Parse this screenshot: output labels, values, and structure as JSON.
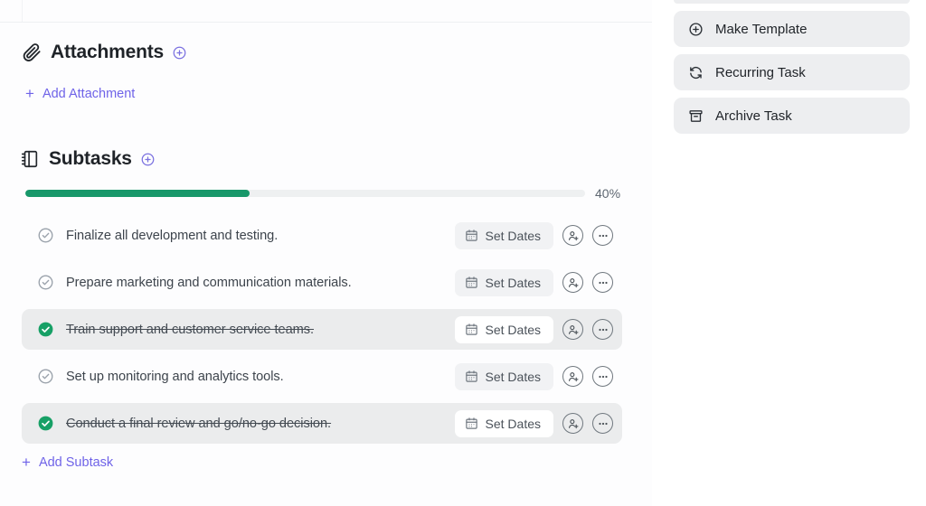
{
  "attachments": {
    "title": "Attachments",
    "icon": "paperclip-icon",
    "add_circle_icon": "plus-circle-icon",
    "add_link_label": "Add Attachment"
  },
  "subtasks": {
    "title": "Subtasks",
    "icon": "notebook-icon",
    "add_circle_icon": "plus-circle-icon",
    "progress": {
      "percent_label": "40%",
      "percent_value": 40,
      "fill_color": "#18986a",
      "track_color": "#eef0f1"
    },
    "row_actions": {
      "set_dates_label": "Set Dates",
      "calendar_icon": "calendar-icon",
      "assign_icon": "assign-user-icon",
      "more_icon": "more-options-icon"
    },
    "items": [
      {
        "label": "Finalize all development and testing.",
        "done": false
      },
      {
        "label": "Prepare marketing and communication materials.",
        "done": false
      },
      {
        "label": "Train support and customer service teams.",
        "done": true
      },
      {
        "label": "Set up monitoring and analytics tools.",
        "done": false
      },
      {
        "label": "Conduct a final review and go/no-go decision.",
        "done": true
      }
    ],
    "add_link_label": "Add Subtask"
  },
  "sidebar": {
    "buttons": [
      {
        "label": "Make Template",
        "icon": "plus-circle-icon"
      },
      {
        "label": "Recurring Task",
        "icon": "recurring-icon"
      },
      {
        "label": "Archive Task",
        "icon": "archive-icon"
      }
    ]
  },
  "colors": {
    "accent_purple": "#6f63e8",
    "success_green": "#18986a",
    "row_done_bg": "#ebeced",
    "chip_bg": "#f1f2f4"
  }
}
